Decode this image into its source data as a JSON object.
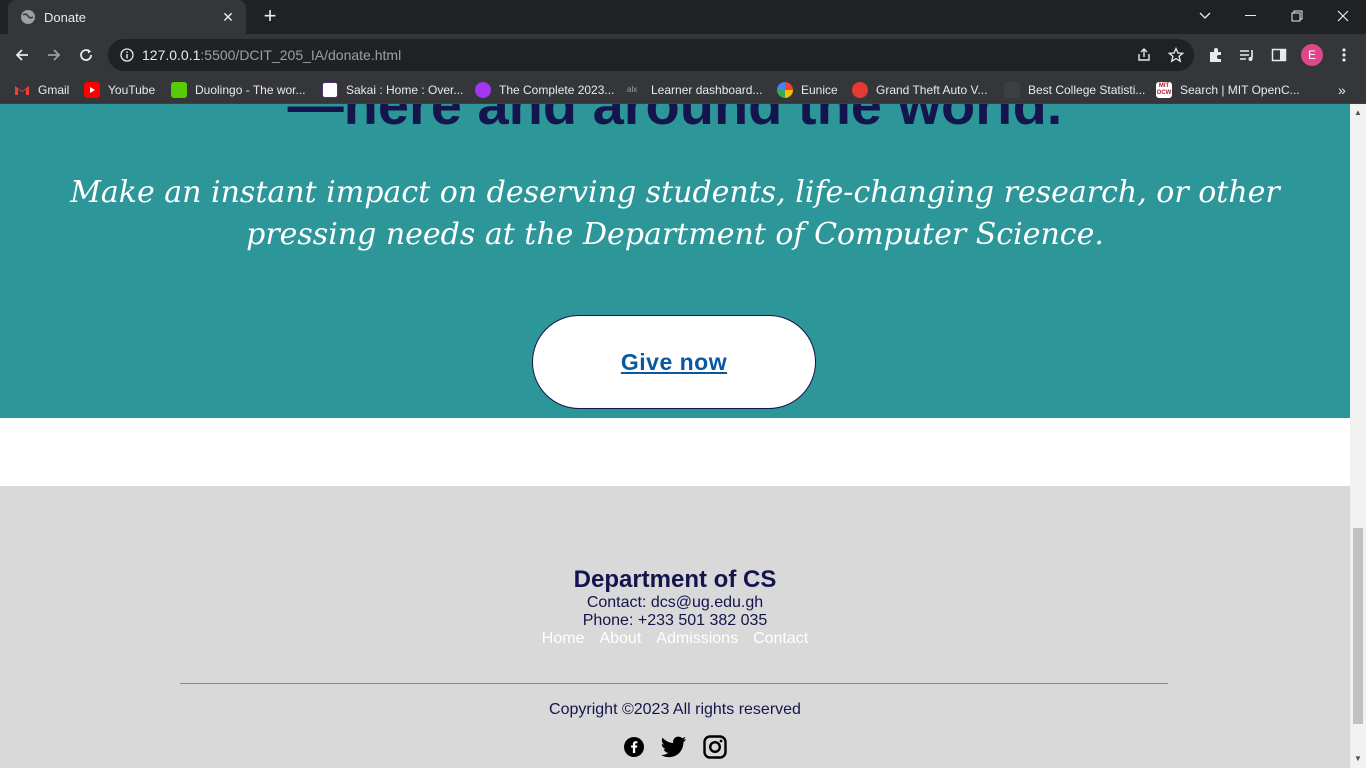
{
  "browser": {
    "tab_title": "Donate",
    "url_host": "127.0.0.1",
    "url_rest": ":5500/DCIT_205_IA/donate.html",
    "profile_initial": "E"
  },
  "bookmarks": [
    {
      "label": "Gmail",
      "icon": "gmail-icon",
      "color": "#ea4335"
    },
    {
      "label": "YouTube",
      "icon": "youtube-icon",
      "color": "#ff0000"
    },
    {
      "label": "Duolingo - The wor...",
      "icon": "duolingo-icon",
      "color": "#58cc02"
    },
    {
      "label": "Sakai : Home : Over...",
      "icon": "sakai-icon",
      "color": "#ffffff"
    },
    {
      "label": "The Complete 2023...",
      "icon": "udemy-icon",
      "color": "#a435f0"
    },
    {
      "label": "Learner dashboard...",
      "icon": "alx-icon",
      "color": "#35363a"
    },
    {
      "label": "Eunice",
      "icon": "eunice-icon",
      "color": "#4285f4"
    },
    {
      "label": "Grand Theft Auto V...",
      "icon": "gta-icon",
      "color": "#e53935"
    },
    {
      "label": "Best College Statisti...",
      "icon": "college-icon",
      "color": "#35363a"
    },
    {
      "label": "Search | MIT OpenC...",
      "icon": "mit-icon",
      "color": "#ffffff"
    }
  ],
  "hero": {
    "heading": "—here and around the world.",
    "text": "Make an instant impact on deserving students, life-changing research, or other pressing needs at the Department of Computer Science.",
    "button": "Give now"
  },
  "footer": {
    "dept": "Department of CS",
    "contact": "Contact: dcs@ug.edu.gh",
    "phone": "Phone: +233 501 382 035",
    "links": [
      "Home",
      "About",
      "Admissions",
      "Contact"
    ],
    "copyright": "Copyright ©2023 All rights reserved"
  }
}
